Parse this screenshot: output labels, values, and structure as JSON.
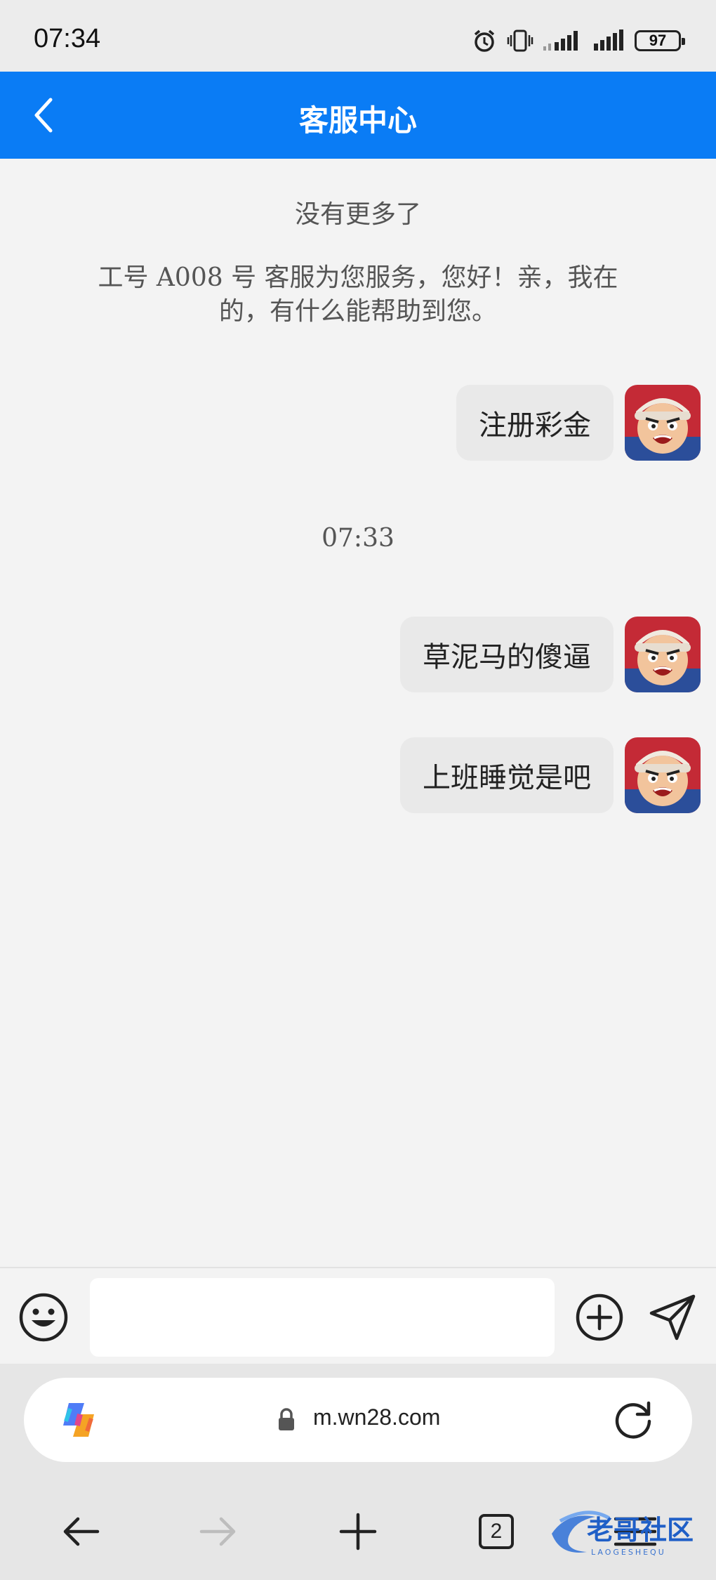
{
  "status_bar": {
    "time": "07:34",
    "battery": "97"
  },
  "header": {
    "title": "客服中心"
  },
  "chat": {
    "no_more": "没有更多了",
    "greeting": "工号 A008 号 客服为您服务，您好！亲，我在的，有什么能帮助到您。",
    "timestamp": "07:33",
    "messages": [
      {
        "text": "注册彩金",
        "sender": "user"
      },
      {
        "text": "草泥马的傻逼",
        "sender": "user"
      },
      {
        "text": "上班睡觉是吧",
        "sender": "user"
      }
    ]
  },
  "input": {
    "value": "",
    "placeholder": ""
  },
  "browser": {
    "url": "m.wn28.com",
    "tab_count": "2"
  },
  "watermark": {
    "text": "老哥社区",
    "subtext": "LAOGESHEQU"
  },
  "colors": {
    "accent": "#0a7cf5",
    "background": "#f3f3f3",
    "bubble": "#e9e9e9"
  }
}
